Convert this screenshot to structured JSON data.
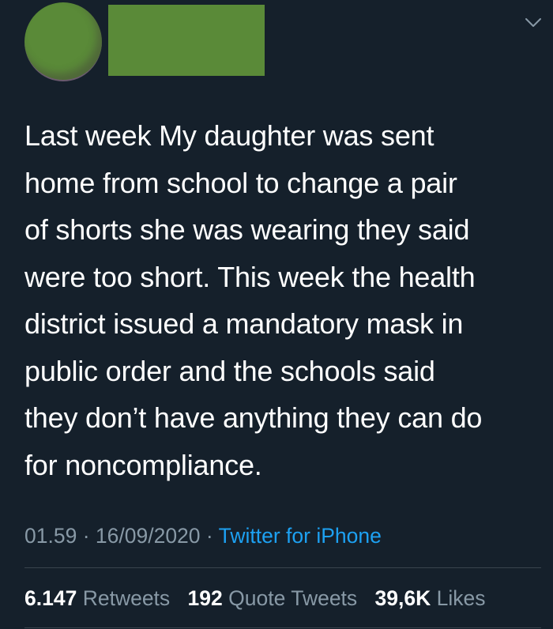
{
  "tweet": {
    "text": "Last week My daughter was sent\nhome from school to change a pair\nof shorts she was wearing they said\nwere too short. This week the health\ndistrict issued a mandatory mask in\npublic order and the schools said\nthey don’t have anything they can do\nfor noncompliance.",
    "time": "01.59",
    "date": "16/09/2020",
    "separator": "·",
    "source": "Twitter for iPhone"
  },
  "stats": {
    "retweets_count": "6.147",
    "retweets_label": "Retweets",
    "quote_count": "192",
    "quote_label": "Quote Tweets",
    "likes_count": "39,6K",
    "likes_label": "Likes"
  },
  "icons": {
    "more": "chevron-down-icon"
  },
  "colors": {
    "background": "#15202b",
    "text": "#ffffff",
    "secondary": "#8899a6",
    "link": "#1da1f2",
    "redaction": "#5a8a38",
    "divider": "#38444d"
  }
}
